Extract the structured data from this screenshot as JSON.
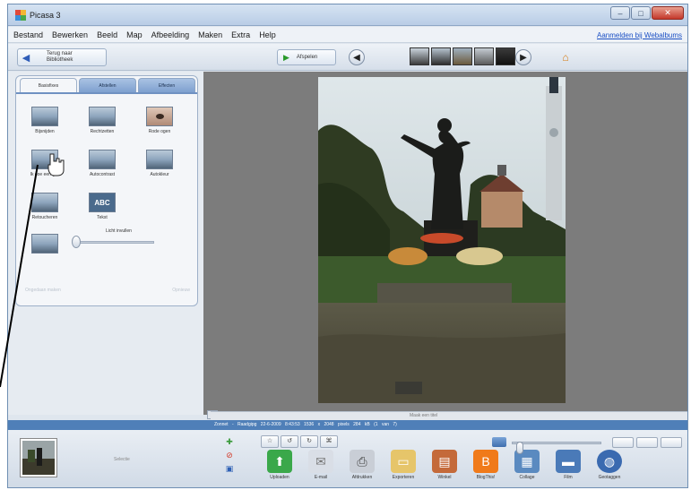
{
  "window": {
    "title": "Picasa 3"
  },
  "menu": {
    "items": [
      "Bestand",
      "Bewerken",
      "Beeld",
      "Map",
      "Afbeelding",
      "Maken",
      "Extra",
      "Help"
    ],
    "right_link": "Aanmelden bij Webalbums"
  },
  "toolbar": {
    "back_label": "Terug naar Bibliotheek",
    "play_label": "Afspelen"
  },
  "tabs": [
    "Basisfixes",
    "Afstellen",
    "Effecten"
  ],
  "tools": [
    {
      "label": "Bijsnijden",
      "icon": "crop-icon"
    },
    {
      "label": "Rechtzetten",
      "icon": "straighten-icon"
    },
    {
      "label": "Rode ogen",
      "icon": "redeye-icon"
    },
    {
      "label": "Ik doe een gok",
      "icon": "feeling-lucky-icon"
    },
    {
      "label": "Autocontrast",
      "icon": "autocontrast-icon"
    },
    {
      "label": "Autokleur",
      "icon": "autocolor-icon"
    },
    {
      "label": "Retoucheren",
      "icon": "retouch-icon"
    },
    {
      "label": "Tekst",
      "icon": "text-icon",
      "glyph": "ABC"
    }
  ],
  "fill_light": {
    "label": "Licht invullen",
    "value": 0.0
  },
  "panel_bottom": {
    "left": "Ongedaan maken",
    "right": "Opnieuw"
  },
  "scroll_caption": "Maak een titel",
  "status": {
    "text": "Zonnet - Raadgipg   22-6-2009 8:43:53   1536 x 2048 pixels   284 kB   (1 van 7)"
  },
  "tray": {
    "label": "Selectie",
    "actions": [
      {
        "label": "Uploaden",
        "icon": "upload-icon",
        "color": "#3aa84a"
      },
      {
        "label": "E-mail",
        "icon": "email-icon",
        "color": "#d9dee6"
      },
      {
        "label": "Afdrukken",
        "icon": "print-icon",
        "color": "#c9ced6"
      },
      {
        "label": "Exporteren",
        "icon": "export-folder-icon",
        "color": "#e6c56a"
      },
      {
        "label": "Winkel",
        "icon": "shop-icon",
        "color": "#c46a3a"
      },
      {
        "label": "BlogThis!",
        "icon": "blogger-icon",
        "color": "#f07a1a"
      },
      {
        "label": "Collage",
        "icon": "collage-icon",
        "color": "#5a8ac0"
      },
      {
        "label": "Film",
        "icon": "movie-icon",
        "color": "#4a7ab8"
      },
      {
        "label": "Geotaggen",
        "icon": "earth-icon",
        "color": "#3a6ab0"
      }
    ]
  },
  "zoom": {
    "value": 0.08
  }
}
